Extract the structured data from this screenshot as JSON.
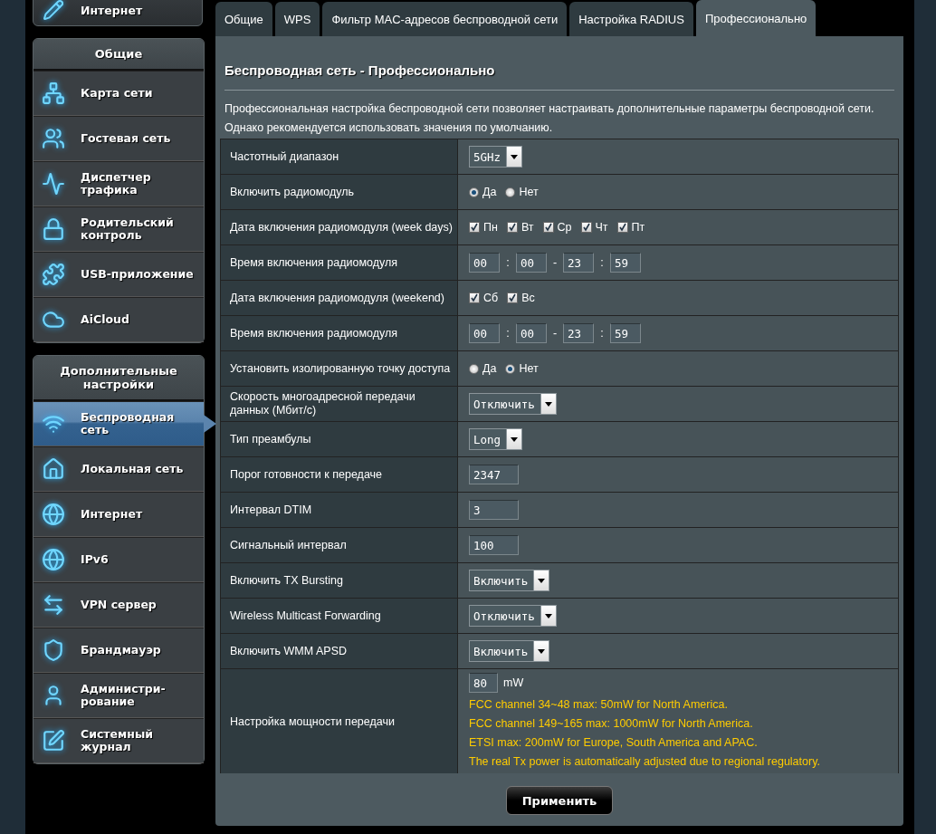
{
  "sidebar": {
    "partial_item": {
      "label": "Интернет"
    },
    "groups": [
      {
        "title": "Общие",
        "items": [
          {
            "label": "Карта сети",
            "selected": false
          },
          {
            "label": "Гостевая сеть",
            "selected": false
          },
          {
            "label": "Диспетчер трафика",
            "selected": false
          },
          {
            "label": "Родительский контроль",
            "selected": false
          },
          {
            "label": "USB-приложение",
            "selected": false
          },
          {
            "label": "AiCloud",
            "selected": false
          }
        ]
      },
      {
        "title": "Дополнительные настройки",
        "items": [
          {
            "label": "Беспроводная сеть",
            "selected": true
          },
          {
            "label": "Локальная сеть",
            "selected": false
          },
          {
            "label": "Интернет",
            "selected": false
          },
          {
            "label": "IPv6",
            "selected": false
          },
          {
            "label": "VPN сервер",
            "selected": false
          },
          {
            "label": "Брандмауэр",
            "selected": false
          },
          {
            "label": "Администри-рование",
            "selected": false
          },
          {
            "label": "Системный журнал",
            "selected": false
          }
        ]
      }
    ]
  },
  "tabs": [
    {
      "label": "Общие",
      "selected": false
    },
    {
      "label": "WPS",
      "selected": false
    },
    {
      "label": "Фильтр MAC-адресов беспроводной сети",
      "selected": false
    },
    {
      "label": "Настройка RADIUS",
      "selected": false
    },
    {
      "label": "Профессионально",
      "selected": true
    }
  ],
  "page": {
    "title": "Беспроводная сеть - Профессионально",
    "description": "Профессиональная настройка беспроводной сети позволяет настраивать дополнительные параметры беспроводной сети. Однако рекомендуется использовать значения по умолчанию."
  },
  "settings": [
    {
      "kind": "select",
      "label": "Частотный диапазон",
      "value": "5GHz"
    },
    {
      "kind": "radio",
      "label": "Включить радиомодуль",
      "options": [
        {
          "label": "Да",
          "selected": true
        },
        {
          "label": "Нет",
          "selected": false
        }
      ]
    },
    {
      "kind": "checkboxes",
      "label": "Дата включения радиомодуля (week days)",
      "options": [
        {
          "label": "Пн",
          "checked": true
        },
        {
          "label": "Вт",
          "checked": true
        },
        {
          "label": "Ср",
          "checked": true
        },
        {
          "label": "Чт",
          "checked": true
        },
        {
          "label": "Пт",
          "checked": true
        }
      ]
    },
    {
      "kind": "time",
      "label": "Время включения радиомодуля",
      "values": [
        "00",
        "00",
        "23",
        "59"
      ],
      "separators": [
        ":",
        "-",
        ":"
      ]
    },
    {
      "kind": "checkboxes",
      "label": "Дата включения радиомодуля (weekend)",
      "options": [
        {
          "label": "Сб",
          "checked": true
        },
        {
          "label": "Вс",
          "checked": true
        }
      ]
    },
    {
      "kind": "time",
      "label": "Время включения радиомодуля",
      "values": [
        "00",
        "00",
        "23",
        "59"
      ],
      "separators": [
        ":",
        "-",
        ":"
      ]
    },
    {
      "kind": "radio",
      "label": "Установить изолированную точку доступа",
      "options": [
        {
          "label": "Да",
          "selected": false
        },
        {
          "label": "Нет",
          "selected": true
        }
      ]
    },
    {
      "kind": "select",
      "label": "Скорость многоадресной передачи данных (Мбит/с)",
      "value": "Отключить"
    },
    {
      "kind": "select",
      "label": "Тип преамбулы",
      "value": "Long"
    },
    {
      "kind": "text",
      "label": "Порог готовности к передаче",
      "value": "2347"
    },
    {
      "kind": "text",
      "label": "Интервал DTIM",
      "value": "3"
    },
    {
      "kind": "text",
      "label": "Сигнальный интервал",
      "value": "100"
    },
    {
      "kind": "select",
      "label": "Включить TX Bursting",
      "value": "Включить"
    },
    {
      "kind": "select",
      "label": "Wireless Multicast Forwarding",
      "value": "Отключить"
    },
    {
      "kind": "select",
      "label": "Включить WMM APSD",
      "value": "Включить"
    },
    {
      "kind": "power",
      "label": "Настройка мощности передачи",
      "value": "80",
      "unit": "mW",
      "notes": [
        "FCC channel 34~48 max: 50mW for North America.",
        "FCC channel 149~165 max: 1000mW for North America.",
        "ETSI max: 200mW for Europe, South America and APAC.",
        "The real Tx power is automatically adjusted due to regional regulatory."
      ]
    }
  ],
  "apply_button": "Применить"
}
